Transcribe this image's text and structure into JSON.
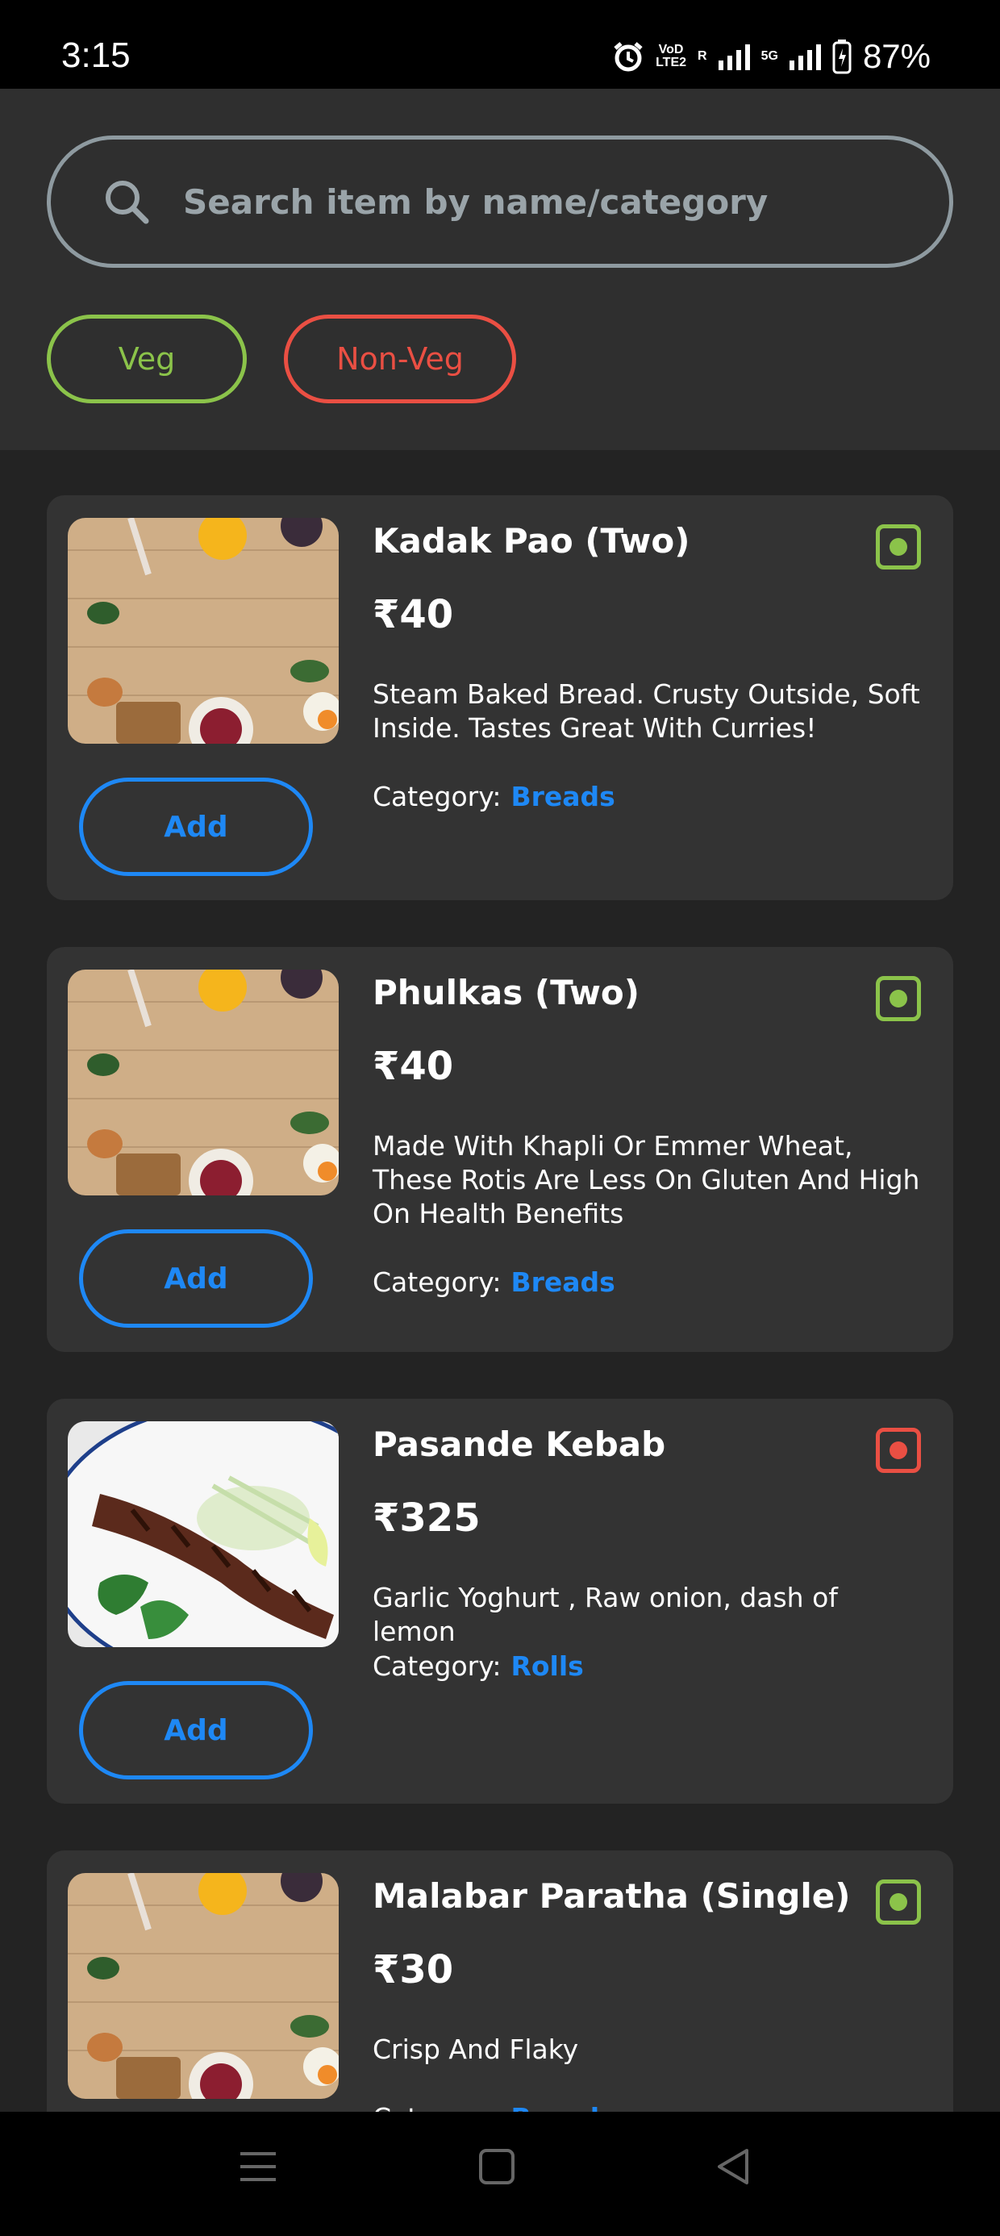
{
  "status_bar": {
    "time": "3:15",
    "net1_top": "VoD",
    "net1_bottom": "LTE2",
    "roaming": "R",
    "net2": "5G",
    "battery": "87%"
  },
  "search": {
    "placeholder": "Search item by name/category"
  },
  "filters": {
    "veg": "Veg",
    "non_veg": "Non-Veg"
  },
  "colors": {
    "veg": "#8bc34a",
    "non_veg": "#ea4f43",
    "accent": "#1e88f5"
  },
  "category_label": "Category:",
  "add_label": "Add",
  "items": [
    {
      "name": "Kadak Pao (Two)",
      "price": "₹40",
      "description": "Steam Baked Bread. Crusty Outside, Soft Inside. Tastes Great With Curries!",
      "category": "Breads",
      "type": "veg",
      "image": "food-flatlay-image"
    },
    {
      "name": "Phulkas (Two)",
      "price": "₹40",
      "description": "Made With Khapli Or Emmer Wheat, These Rotis Are Less On Gluten And High On Health Benefits",
      "category": "Breads",
      "type": "veg",
      "image": "food-flatlay-image"
    },
    {
      "name": "Pasande Kebab",
      "price": "₹325",
      "description": "Garlic Yoghurt , Raw onion, dash of lemon",
      "category": "Rolls",
      "type": "non-veg",
      "image": "kebab-plate-image"
    },
    {
      "name": "Malabar Paratha (Single)",
      "price": "₹30",
      "description": "Crisp And Flaky",
      "category": "Breads",
      "type": "veg",
      "image": "food-flatlay-image"
    }
  ]
}
